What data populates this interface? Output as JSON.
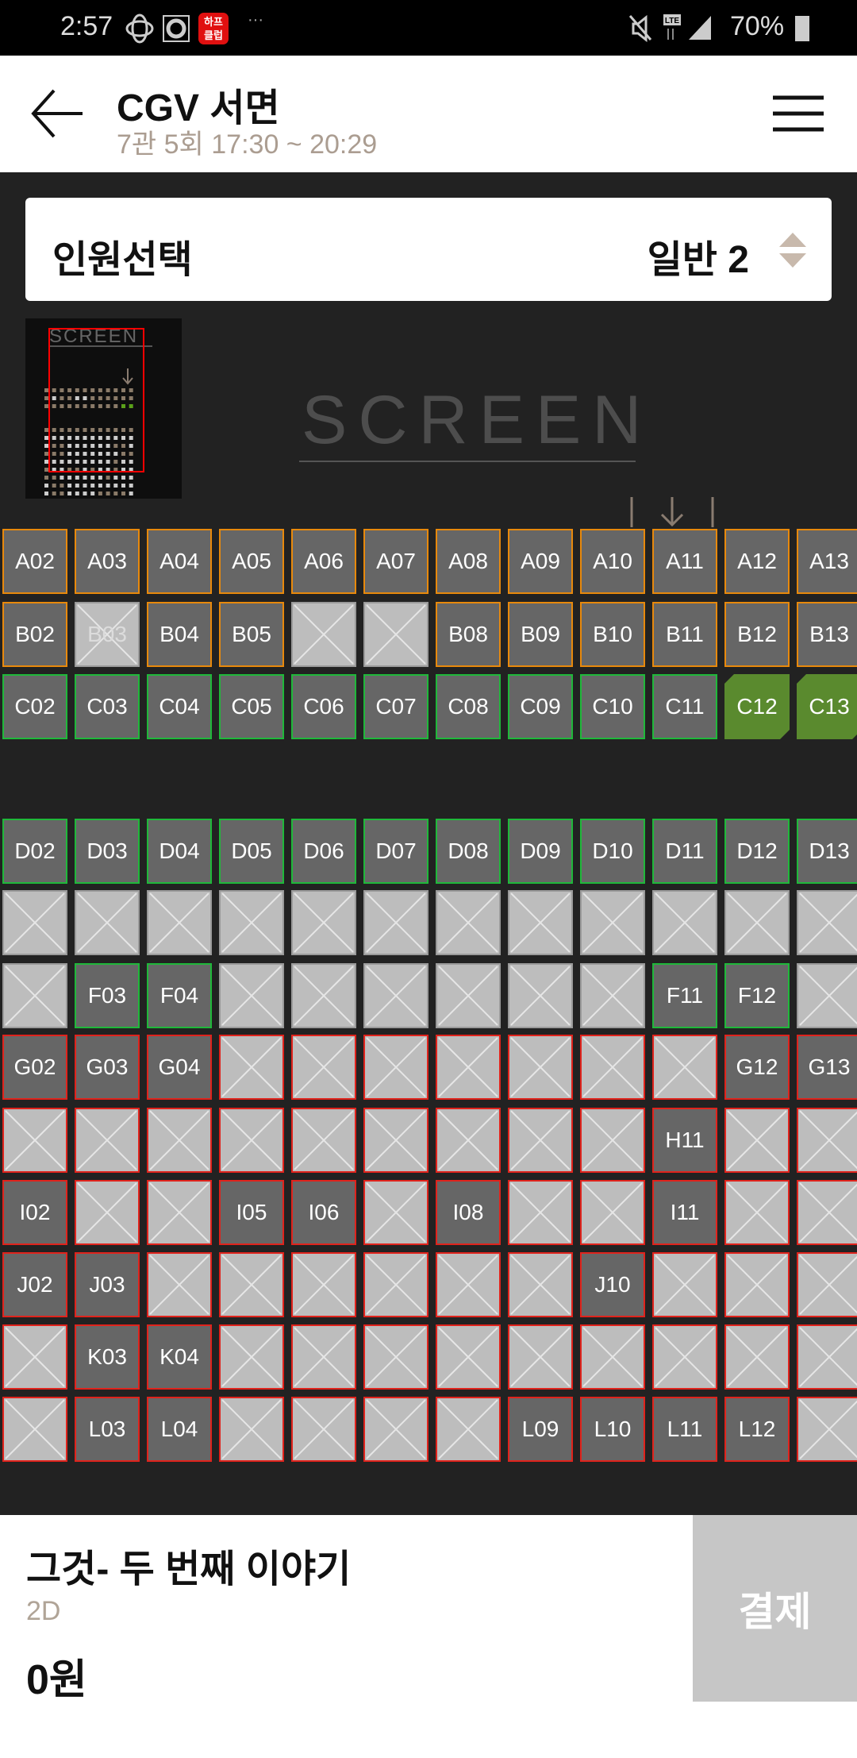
{
  "status_bar": {
    "time": "2:57",
    "battery": "70%",
    "notification_badge": "하프클럽",
    "icons": [
      "vpn-icon",
      "record-icon",
      "app-badge-icon",
      "more-icon",
      "mute-icon",
      "lte-icon",
      "signal-icon",
      "battery-icon"
    ]
  },
  "header": {
    "title": "CGV 서면",
    "subtitle": "7관 5회 17:30 ~ 20:29",
    "back_icon": "arrow-left-icon",
    "menu_icon": "hamburger-icon"
  },
  "people_selector": {
    "label": "인원선택",
    "value": "일반 2",
    "icon": "sort-arrows-icon"
  },
  "screen": {
    "label": "SCREEN",
    "minimap_label": "SCREEN"
  },
  "colors": {
    "zone_orange": "#e8890c",
    "zone_green": "#1fb83a",
    "zone_red": "#e0231c",
    "selected": "#5a8a2e",
    "available": "#666666",
    "unavailable": "#bdbdbd",
    "accent_text": "#ab9d91"
  },
  "columns": [
    "02",
    "03",
    "04",
    "05",
    "06",
    "07",
    "08",
    "09",
    "10",
    "11",
    "12",
    "13"
  ],
  "seat_rows": [
    {
      "row": "A",
      "zone": "orange",
      "seats": [
        "a",
        "a",
        "a",
        "a",
        "a",
        "a",
        "a",
        "a",
        "a",
        "a",
        "a",
        "a"
      ]
    },
    {
      "row": "B",
      "zone": "orange",
      "seats": [
        "a",
        "xl",
        "a",
        "a",
        "x",
        "x",
        "a",
        "a",
        "a",
        "a",
        "a",
        "a"
      ]
    },
    {
      "row": "C",
      "zone": "green",
      "seats": [
        "a",
        "a",
        "a",
        "a",
        "a",
        "a",
        "a",
        "a",
        "a",
        "a",
        "s",
        "s"
      ]
    },
    {
      "row": "D",
      "zone": "green",
      "seats": [
        "a",
        "a",
        "a",
        "a",
        "a",
        "a",
        "a",
        "a",
        "a",
        "a",
        "a",
        "a"
      ]
    },
    {
      "row": "E",
      "zone": "green",
      "seats": [
        "x",
        "x",
        "x",
        "x",
        "x",
        "x",
        "x",
        "x",
        "x",
        "x",
        "x",
        "x"
      ]
    },
    {
      "row": "F",
      "zone": "green",
      "seats": [
        "x",
        "a",
        "a",
        "x",
        "x",
        "x",
        "x",
        "x",
        "x",
        "a",
        "a",
        "x"
      ]
    },
    {
      "row": "G",
      "zone": "red",
      "seats": [
        "a",
        "a",
        "a",
        "x",
        "x",
        "x",
        "x",
        "x",
        "x",
        "x",
        "a",
        "a"
      ]
    },
    {
      "row": "H",
      "zone": "red",
      "seats": [
        "x",
        "x",
        "x",
        "x",
        "x",
        "x",
        "x",
        "x",
        "x",
        "a",
        "x",
        "x"
      ]
    },
    {
      "row": "I",
      "zone": "red",
      "seats": [
        "a",
        "x",
        "x",
        "a",
        "a",
        "x",
        "a",
        "x",
        "x",
        "a",
        "x",
        "x"
      ]
    },
    {
      "row": "J",
      "zone": "red",
      "seats": [
        "a",
        "a",
        "x",
        "x",
        "x",
        "x",
        "x",
        "x",
        "a",
        "x",
        "x",
        "x"
      ]
    },
    {
      "row": "K",
      "zone": "red",
      "seats": [
        "x",
        "a",
        "a",
        "x",
        "x",
        "x",
        "x",
        "x",
        "x",
        "x",
        "x",
        "x"
      ]
    },
    {
      "row": "L",
      "zone": "red",
      "seats": [
        "x",
        "a",
        "a",
        "x",
        "x",
        "x",
        "x",
        "a",
        "a",
        "a",
        "a",
        "x"
      ]
    }
  ],
  "footer": {
    "movie_title": "그것- 두 번째 이야기",
    "format": "2D",
    "price": "0원",
    "pay_button": "결제"
  }
}
